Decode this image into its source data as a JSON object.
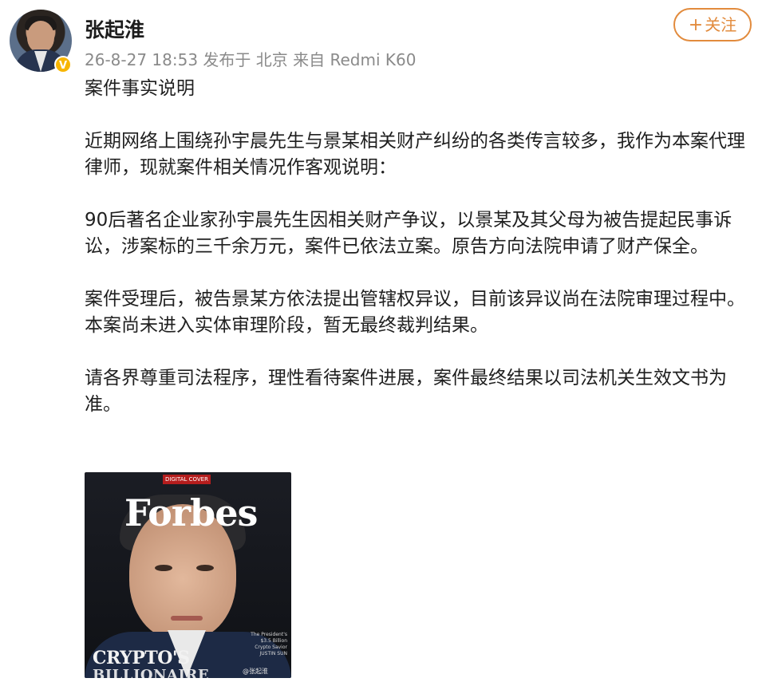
{
  "post": {
    "author": "张起淮",
    "verified_mark": "V",
    "meta": "26-8-27 18:53  发布于 北京  来自 Redmi K60",
    "follow_label": "关注",
    "follow_plus": "+",
    "paragraphs": [
      "案件事实说明",
      "近期网络上围绕孙宇晨先生与景某相关财产纠纷的各类传言较多，我作为本案代理律师，现就案件相关情况作客观说明：",
      "90后著名企业家孙宇晨先生因相关财产争议，以景某及其父母为被告提起民事诉讼，涉案标的三千余万元，案件已依法立案。原告方向法院申请了财产保全。",
      "案件受理后，被告景某方依法提出管辖权异议，目前该异议尚在法院审理过程中。本案尚未进入实体审理阶段，暂无最终裁判结果。",
      "请各界尊重司法程序，理性看待案件进展，案件最终结果以司法机关生效文书为准。"
    ]
  },
  "image": {
    "tag": "DIGITAL COVER",
    "brand": "Forbes",
    "caption": "The President's $3.5 Billion Crypto Savior JUSTIN SUN",
    "bottom_line1": "CRYPTO'S",
    "bottom_line2": "BILLIONAIRE BARRIER",
    "watermark": "@张起淮"
  },
  "colors": {
    "accent": "#e28b3d",
    "meta_text": "#8a8a8a",
    "verified": "#f7b500"
  }
}
